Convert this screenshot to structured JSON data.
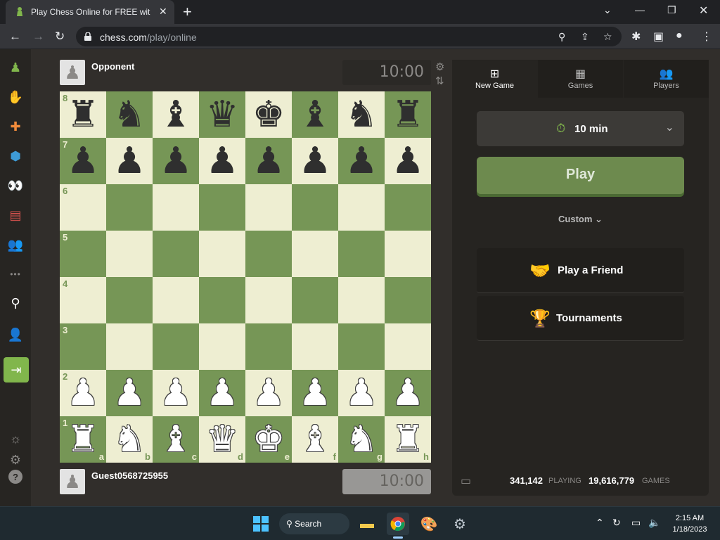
{
  "browser": {
    "tab_title": "Play Chess Online for FREE with F",
    "url_host": "chess.com",
    "url_path": "/play/online"
  },
  "icons": {
    "back": "back-arrow-icon",
    "forward": "forward-arrow-icon",
    "reload": "reload-icon",
    "zoom": "zoom-icon",
    "share": "share-icon",
    "bookmark": "star-icon",
    "extensions": "puzzle-icon",
    "sidepanel": "sidepanel-icon",
    "profile": "profile-icon",
    "menu": "kebab-menu-icon"
  },
  "left_nav": [
    {
      "name": "chess-logo-icon",
      "glyph": "♟",
      "color": "#81b64c"
    },
    {
      "name": "play-icon",
      "glyph": "✋",
      "color": "#f4c49e"
    },
    {
      "name": "puzzles-icon",
      "glyph": "✚",
      "color": "#f18b3b"
    },
    {
      "name": "learn-icon",
      "glyph": "⬢",
      "color": "#3e9bd6"
    },
    {
      "name": "watch-icon",
      "glyph": "👀",
      "color": "#d0d0d0"
    },
    {
      "name": "news-icon",
      "glyph": "▤",
      "color": "#d9534f"
    },
    {
      "name": "social-icon",
      "glyph": "👥",
      "color": "#e7b9a0"
    },
    {
      "name": "more-icon",
      "glyph": "•••",
      "color": "#8b8987"
    },
    {
      "name": "search-icon",
      "glyph": "⚲",
      "color": "#ffffff"
    },
    {
      "name": "add-friend-icon",
      "glyph": "👤",
      "color": "#bababa"
    }
  ],
  "left_nav_bottom": [
    {
      "name": "theme-icon",
      "glyph": "☼"
    },
    {
      "name": "settings-icon",
      "glyph": "⚙"
    },
    {
      "name": "help-icon",
      "glyph": "?"
    }
  ],
  "players": {
    "top": {
      "name": "Opponent",
      "clock": "10:00"
    },
    "bottom": {
      "name": "Guest0568725955",
      "clock": "10:00"
    }
  },
  "board": {
    "ranks": [
      "8",
      "7",
      "6",
      "5",
      "4",
      "3",
      "2",
      "1"
    ],
    "files": [
      "a",
      "b",
      "c",
      "d",
      "e",
      "f",
      "g",
      "h"
    ],
    "position": [
      [
        "r",
        "n",
        "b",
        "q",
        "k",
        "b",
        "n",
        "r"
      ],
      [
        "p",
        "p",
        "p",
        "p",
        "p",
        "p",
        "p",
        "p"
      ],
      [
        "",
        "",
        "",
        "",
        "",
        "",
        "",
        ""
      ],
      [
        "",
        "",
        "",
        "",
        "",
        "",
        "",
        ""
      ],
      [
        "",
        "",
        "",
        "",
        "",
        "",
        "",
        ""
      ],
      [
        "",
        "",
        "",
        "",
        "",
        "",
        "",
        ""
      ],
      [
        "P",
        "P",
        "P",
        "P",
        "P",
        "P",
        "P",
        "P"
      ],
      [
        "R",
        "N",
        "B",
        "Q",
        "K",
        "B",
        "N",
        "R"
      ]
    ]
  },
  "panel": {
    "tabs": [
      {
        "label": "New Game",
        "icon": "plus-square-icon",
        "glyph": "⊞"
      },
      {
        "label": "Games",
        "icon": "checkerboard-icon",
        "glyph": "▦"
      },
      {
        "label": "Players",
        "icon": "players-icon",
        "glyph": "👥"
      }
    ],
    "time_control": "10 min",
    "play_label": "Play",
    "custom_label": "Custom",
    "options": [
      {
        "label": "Play a Friend",
        "icon": "handshake-icon",
        "glyph": "🤝"
      },
      {
        "label": "Tournaments",
        "icon": "trophy-icon",
        "glyph": "🏆"
      }
    ],
    "stats": {
      "playing_count": "341,142",
      "playing_label": "PLAYING",
      "games_count": "19,616,779",
      "games_label": "GAMES"
    }
  },
  "taskbar": {
    "search_label": "Search",
    "time": "2:15 AM",
    "date": "1/18/2023"
  }
}
